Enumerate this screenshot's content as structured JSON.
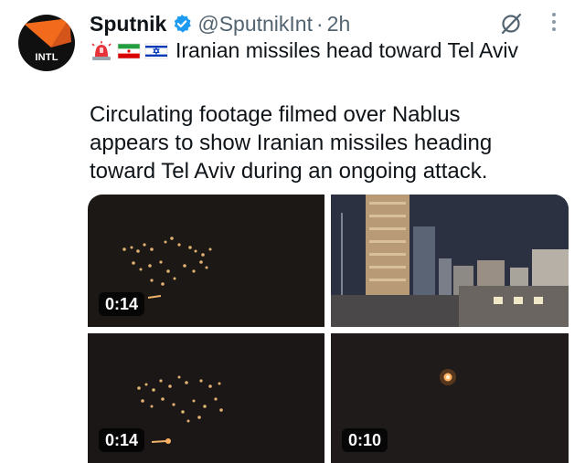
{
  "tweet": {
    "author_name": "Sputnik",
    "author_handle": "@SputnikInt",
    "separator": "·",
    "time": "2h",
    "avatar_label": "INTL",
    "subtitle_emojis": [
      "rotating-light",
      "iran-flag",
      "israel-flag"
    ],
    "subtitle": "Iranian missiles head toward Tel Aviv",
    "body_lines": [
      "Circulating footage filmed over Nablus",
      "appears to show Iranian missiles heading",
      "toward Tel Aviv during an ongoing attack."
    ],
    "media": [
      {
        "duration": "0:14"
      },
      {
        "duration": ""
      },
      {
        "duration": "0:14"
      },
      {
        "duration": "0:10"
      }
    ]
  },
  "colors": {
    "text": "#0f1419",
    "secondary": "#536471",
    "verified": "#1d9bf0",
    "brand_orange": "#f26b1d"
  },
  "icons": [
    "verified-badge-icon",
    "grok-icon",
    "more-icon"
  ]
}
